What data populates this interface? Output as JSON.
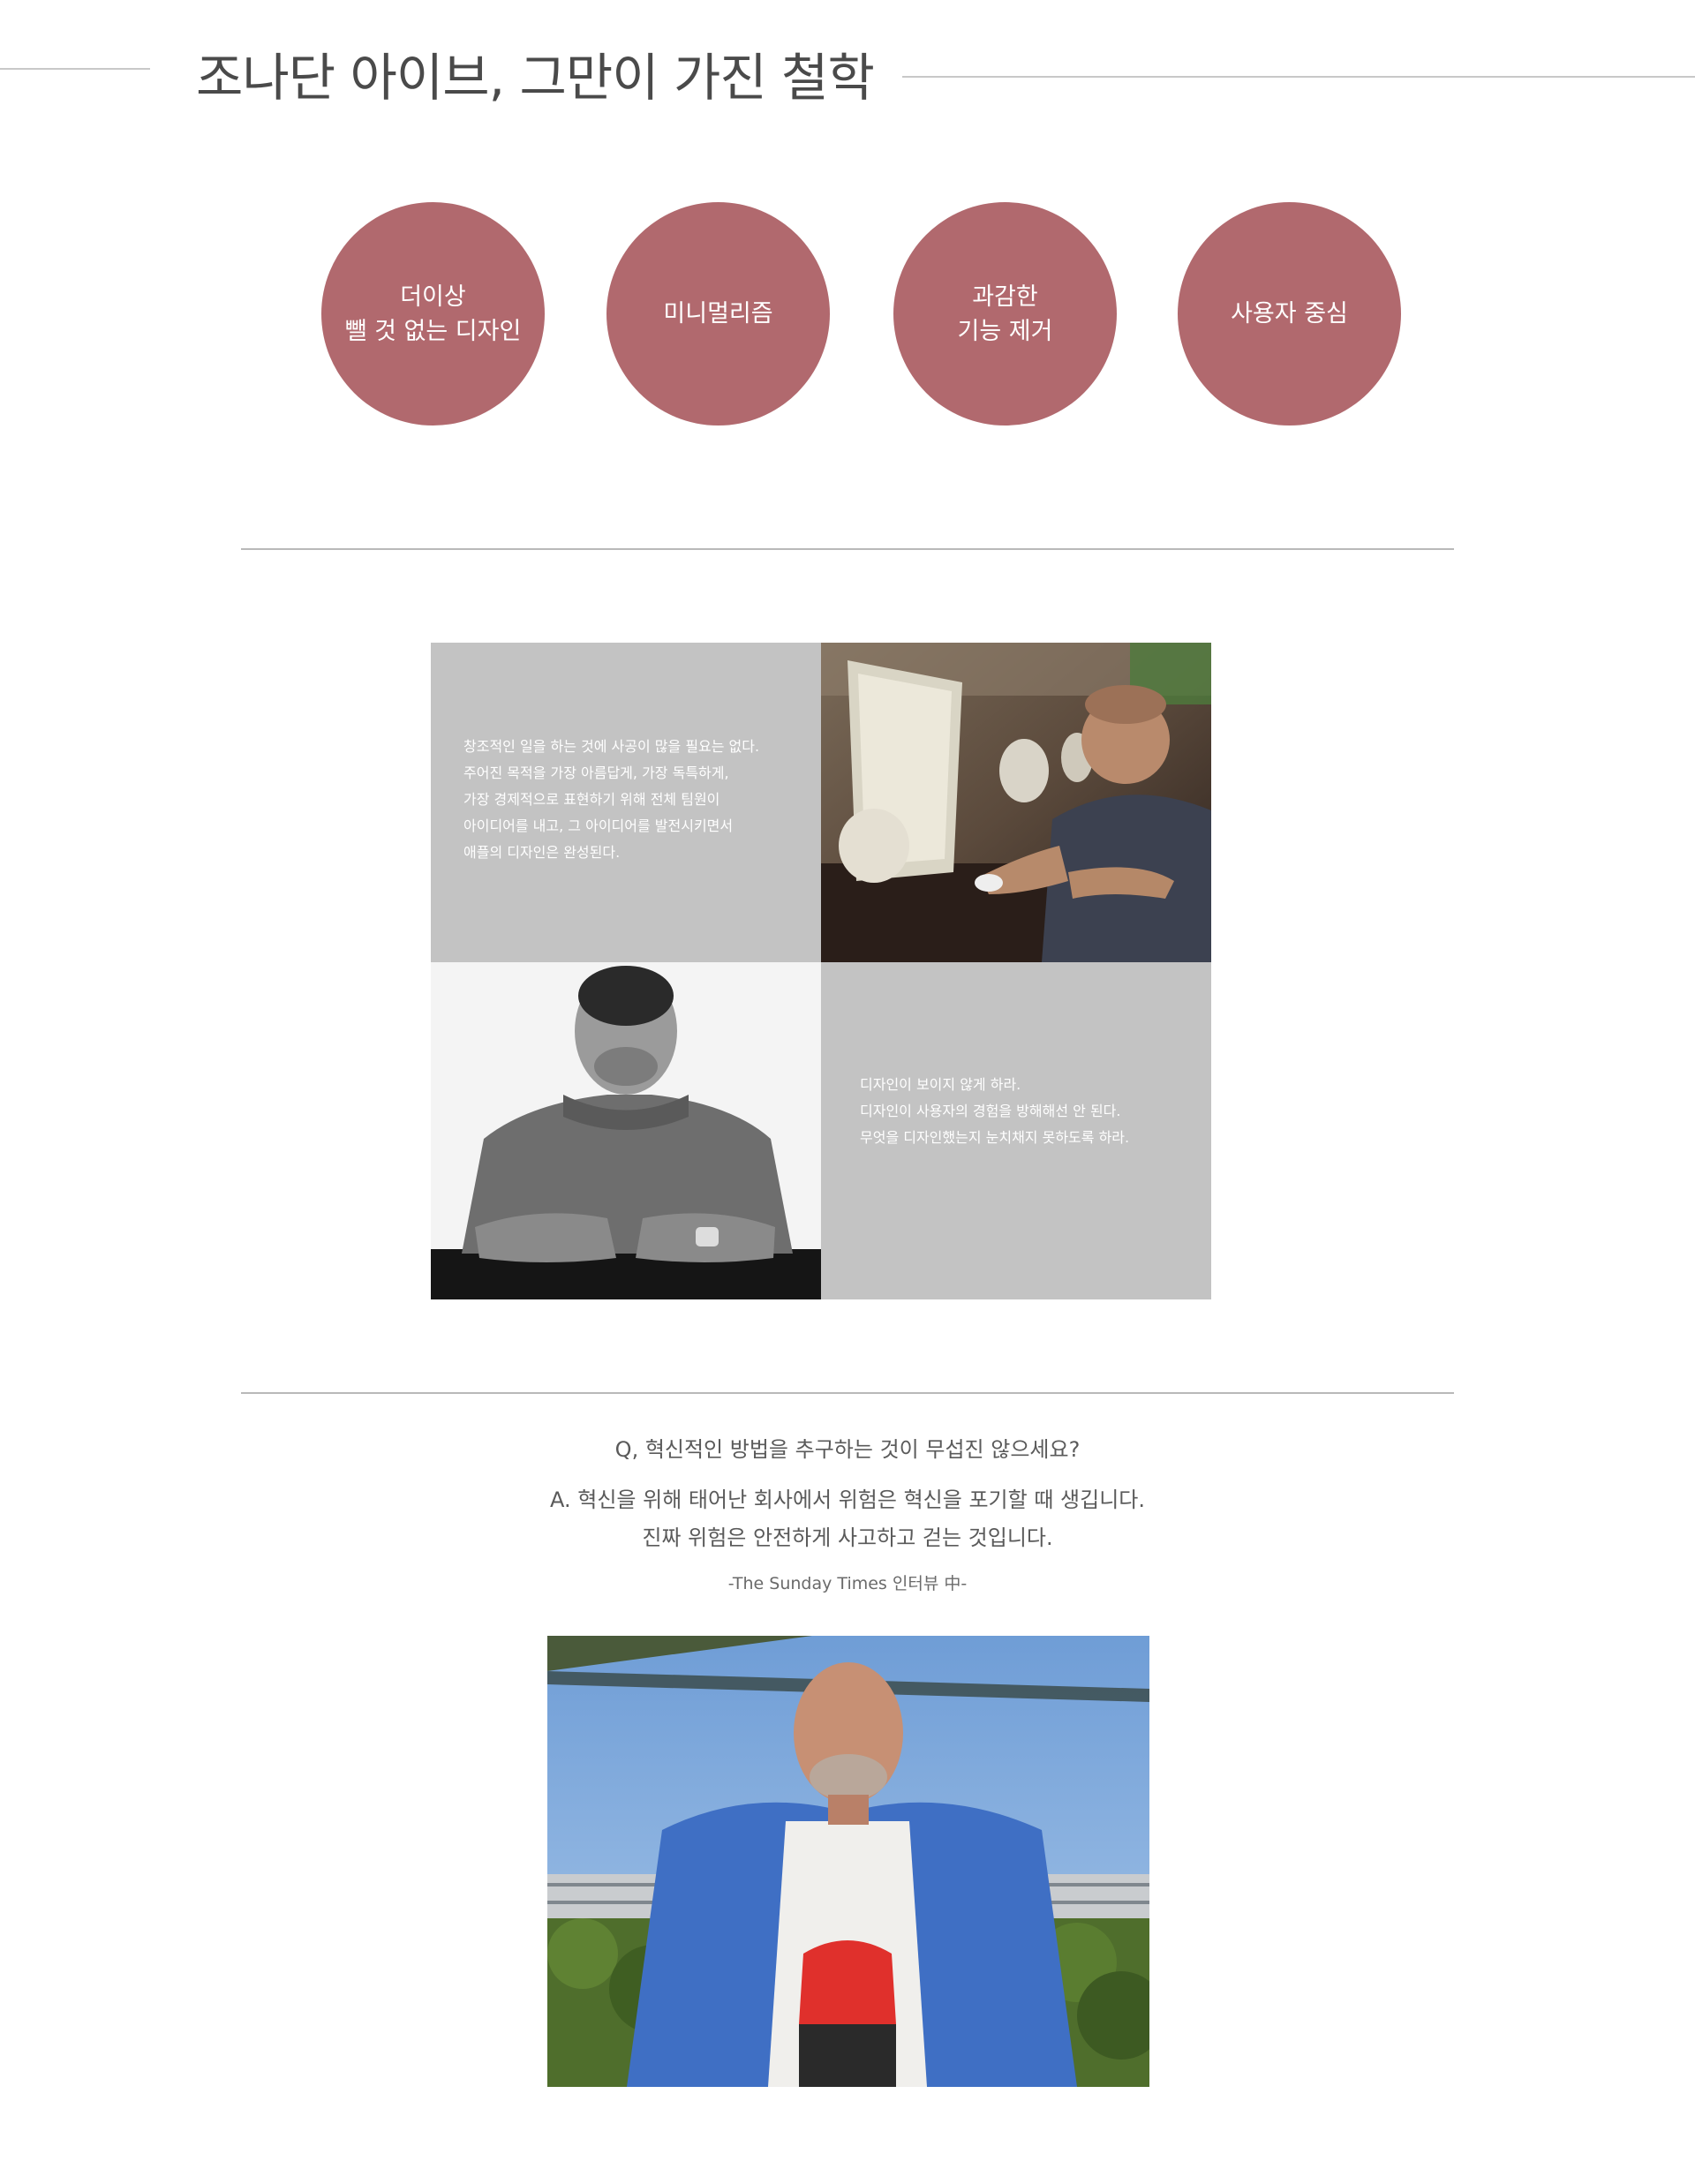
{
  "header": {
    "title": "조나단 아이브, 그만이 가진 철학"
  },
  "philosophy": [
    {
      "label": "더이상\n뺄 것 없는 디자인"
    },
    {
      "label": "미니멀리즘"
    },
    {
      "label": "과감한\n기능 제거"
    },
    {
      "label": "사용자 중심"
    }
  ],
  "quotes": {
    "first": "창조적인 일을 하는 것에 사공이 많을 필요는 없다.\n주어진 목적을 가장 아름답게, 가장 독특하게,\n가장 경제적으로 표현하기 위해 전체 팀원이\n아이디어를 내고, 그 아이디어를 발전시키면서\n애플의 디자인은 완성된다.",
    "second": "디자인이 보이지 않게 하라.\n디자인이 사용자의 경험을 방해해선 안 된다.\n무엇을 디자인했는지 눈치채지 못하도록 하라."
  },
  "interview": {
    "question": "Q, 혁신적인 방법을 추구하는 것이 무섭진 않으세요?",
    "answer_line1": "A. 혁신을 위해 태어난 회사에서 위험은 혁신을 포기할 때 생깁니다.",
    "answer_line2": "진짜 위험은 안전하게 사고하고 걷는 것입니다.",
    "source": "-The Sunday Times 인터뷰 中-"
  },
  "colors": {
    "accent": "#b1696e",
    "quote_panel": "#c3c3c3",
    "divider": "#b9b9b9"
  }
}
